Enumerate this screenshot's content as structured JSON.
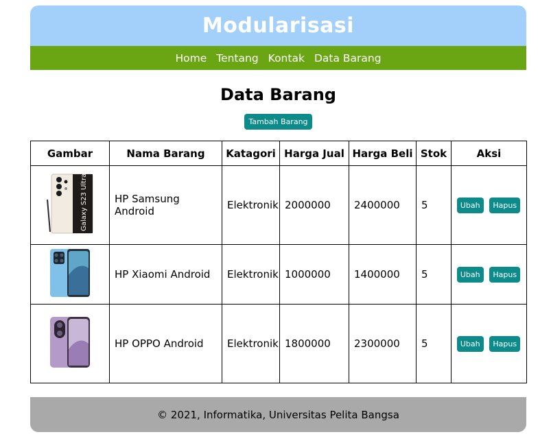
{
  "header": {
    "title": "Modularisasi"
  },
  "nav": {
    "items": [
      "Home",
      "Tentang",
      "Kontak",
      "Data Barang"
    ]
  },
  "main": {
    "title": "Data Barang",
    "add_button": "Tambah Barang",
    "columns": [
      "Gambar",
      "Nama Barang",
      "Katagori",
      "Harga Jual",
      "Harga Beli",
      "Stok",
      "Aksi"
    ],
    "rows": [
      {
        "name": "HP Samsung Android",
        "category": "Elektronik",
        "sell": "2000000",
        "buy": "2400000",
        "stock": "5",
        "image_text": "Galaxy S23 Ultra"
      },
      {
        "name": "HP Xiaomi Android",
        "category": "Elektronik",
        "sell": "1000000",
        "buy": "1400000",
        "stock": "5"
      },
      {
        "name": "HP OPPO Android",
        "category": "Elektronik",
        "sell": "1800000",
        "buy": "2300000",
        "stock": "5"
      }
    ],
    "edit_label": "Ubah",
    "delete_label": "Hapus"
  },
  "footer": {
    "text": "© 2021, Informatika, Universitas Pelita Bangsa"
  },
  "colors": {
    "header_bg": "#a3d0fb",
    "nav_bg": "#6aa614",
    "button_bg": "#0d8a8a",
    "footer_bg": "#a9a9a9"
  }
}
